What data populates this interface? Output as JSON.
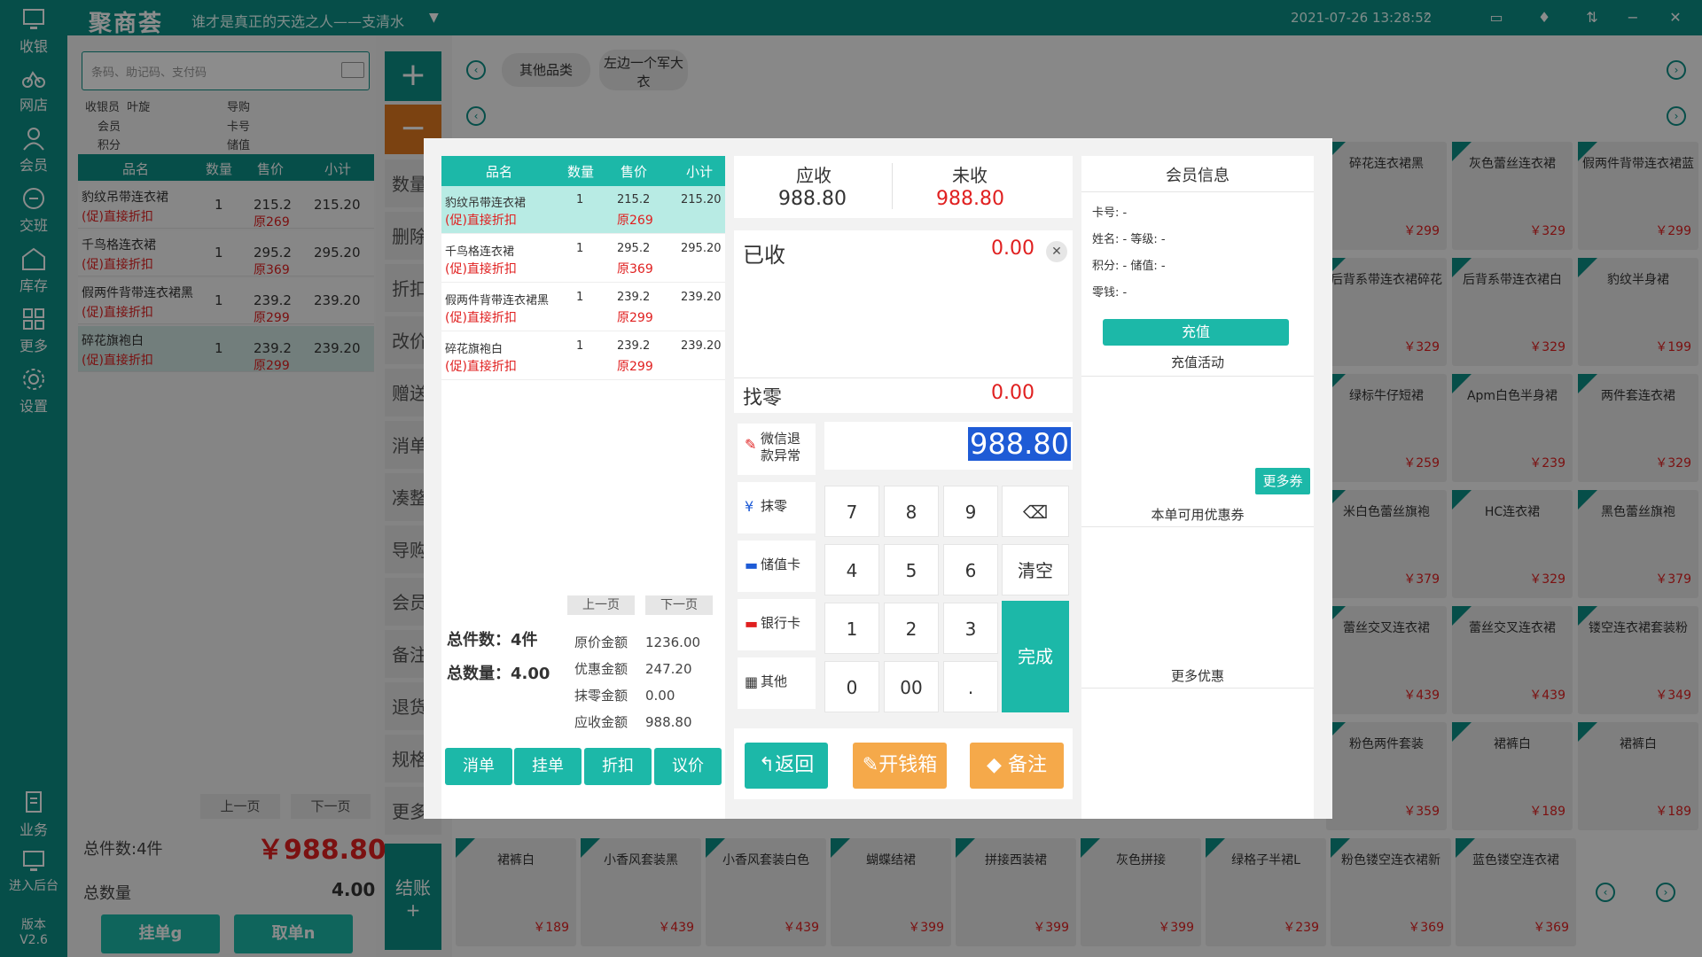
{
  "app": {
    "logo": "聚商荟",
    "slogan": "谁才是真正的天选之人——支清水",
    "datetime": "2021-07-26 13:28:52",
    "version_label": "版本",
    "version": "V2.6"
  },
  "nav": [
    "收银",
    "网店",
    "会员",
    "交班",
    "库存",
    "更多",
    "设置"
  ],
  "nav_bottom": [
    "业务",
    "进入后台"
  ],
  "search": {
    "placeholder": "条码、助记码、支付码"
  },
  "info": {
    "cashier_label": "收银员",
    "cashier": "叶旋",
    "guide_label": "导购",
    "member_label": "会员",
    "card_label": "卡号",
    "points_label": "积分",
    "balance_label": "储值"
  },
  "cart": {
    "headers": [
      "品名",
      "数量",
      "售价",
      "小计"
    ],
    "rows": [
      {
        "name": "豹纹吊带连衣裙",
        "qty": "1",
        "price": "215.2",
        "subtotal": "215.20",
        "promo": "(促)直接折扣",
        "orig": "原269"
      },
      {
        "name": "千鸟格连衣裙",
        "qty": "1",
        "price": "295.2",
        "subtotal": "295.20",
        "promo": "(促)直接折扣",
        "orig": "原369"
      },
      {
        "name": "假两件背带连衣裙黑",
        "qty": "1",
        "price": "239.2",
        "subtotal": "239.20",
        "promo": "(促)直接折扣",
        "orig": "原299"
      },
      {
        "name": "碎花旗袍白",
        "qty": "1",
        "price": "239.2",
        "subtotal": "239.20",
        "promo": "(促)直接折扣",
        "orig": "原299"
      }
    ],
    "prev": "上一页",
    "next": "下一页",
    "total_items": "总件数:4件",
    "total_amount": "￥988.80",
    "total_qty_label": "总数量",
    "total_qty": "4.00",
    "hold": "挂单g",
    "retrieve": "取单n"
  },
  "mid_buttons": [
    "数量",
    "删除",
    "折扣",
    "改价",
    "赠送",
    "消单",
    "凑整",
    "导购",
    "会员",
    "备注",
    "退货",
    "规格",
    "更多"
  ],
  "checkout": "结账",
  "categories": [
    "其他品类",
    "左边一个军大衣"
  ],
  "products": [
    {
      "name": "碎花连衣裙黑",
      "price": "￥299"
    },
    {
      "name": "灰色蕾丝连衣裙",
      "price": "￥329"
    },
    {
      "name": "假两件背带连衣裙蓝",
      "price": "￥299"
    },
    {
      "name": "后背系带连衣裙碎花",
      "price": "￥329"
    },
    {
      "name": "后背系带连衣裙白",
      "price": "￥329"
    },
    {
      "name": "豹纹半身裙",
      "price": "￥199"
    },
    {
      "name": "绿标牛仔短裙",
      "price": "￥259"
    },
    {
      "name": "Apm白色半身裙",
      "price": "￥239"
    },
    {
      "name": "两件套连衣裙",
      "price": "￥329"
    },
    {
      "name": "米白色蕾丝旗袍",
      "price": "￥379"
    },
    {
      "name": "HC连衣裙",
      "price": "￥329"
    },
    {
      "name": "黑色蕾丝旗袍",
      "price": "￥379"
    },
    {
      "name": "蕾丝交叉连衣裙",
      "price": "￥439"
    },
    {
      "name": "蕾丝交叉连衣裙",
      "price": "￥439"
    },
    {
      "name": "镂空连衣裙套装粉",
      "price": "￥349"
    },
    {
      "name": "粉色两件套装",
      "price": "￥359"
    },
    {
      "name": "裙裤白",
      "price": "￥189"
    },
    {
      "name": "裙裤白",
      "price": "￥189"
    }
  ],
  "bottom_products": [
    {
      "name": "裙裤白",
      "price": "￥189"
    },
    {
      "name": "小香风套装黑",
      "price": "￥439"
    },
    {
      "name": "小香风套装白色",
      "price": "￥439"
    },
    {
      "name": "蝴蝶结裙",
      "price": "￥399"
    },
    {
      "name": "拼接西装裙",
      "price": "￥399"
    },
    {
      "name": "灰色拼接",
      "price": "￥399"
    },
    {
      "name": "绿格子半裙L",
      "price": "￥239"
    },
    {
      "name": "粉色镂空连衣裙新",
      "price": "￥369"
    },
    {
      "name": "蓝色镂空连衣裙",
      "price": "￥369"
    }
  ],
  "modal": {
    "headers": [
      "品名",
      "数量",
      "售价",
      "小计"
    ],
    "rows": [
      {
        "name": "豹纹吊带连衣裙",
        "qty": "1",
        "price": "215.2",
        "subtotal": "215.20",
        "promo": "(促)直接折扣",
        "orig": "原269"
      },
      {
        "name": "千鸟格连衣裙",
        "qty": "1",
        "price": "295.2",
        "subtotal": "295.20",
        "promo": "(促)直接折扣",
        "orig": "原369"
      },
      {
        "name": "假两件背带连衣裙黑",
        "qty": "1",
        "price": "239.2",
        "subtotal": "239.20",
        "promo": "(促)直接折扣",
        "orig": "原299"
      },
      {
        "name": "碎花旗袍白",
        "qty": "1",
        "price": "239.2",
        "subtotal": "239.20",
        "promo": "(促)直接折扣",
        "orig": "原299"
      }
    ],
    "prev": "上一页",
    "next": "下一页",
    "total_items": "总件数：4件",
    "total_qty": "总数量：4.00",
    "orig_label": "原价金额",
    "orig_value": "1236.00",
    "disc_label": "优惠金额",
    "disc_value": "247.20",
    "round_label": "抹零金额",
    "round_value": "0.00",
    "due_label": "应收金额",
    "due_value": "988.80",
    "btn_cancel": "消单",
    "btn_hold": "挂单",
    "btn_discount": "折扣",
    "btn_bargain": "议价",
    "receivable_label": "应收",
    "receivable": "988.80",
    "unpaid_label": "未收",
    "unpaid": "988.80",
    "received_label": "已收",
    "received": "0.00",
    "change_label": "找零",
    "change": "0.00",
    "input_value": "988.80",
    "payopts": [
      "微信退款异常",
      "抹零",
      "储值卡",
      "银行卡",
      "其他"
    ],
    "keys": [
      "7",
      "8",
      "9",
      "4",
      "5",
      "6",
      "1",
      "2",
      "3",
      "0",
      "00",
      "."
    ],
    "clear": "清空",
    "done": "完成",
    "back": "返回",
    "drawer": "开钱箱",
    "remark": "备注",
    "member_title": "会员信息",
    "card_no": "卡号: -",
    "name_level": "姓名: -  等级: -",
    "points_bal": "积分: -  储值: -",
    "change_money": "零钱: -",
    "recharge": "充值",
    "recharge_activity": "充值活动",
    "more_coupons": "更多券",
    "available_coupons": "本单可用优惠券",
    "more_offers": "更多优惠"
  },
  "colors": {
    "teal": "#0b8f86",
    "accent": "#1cb8a8",
    "orange": "#f5a94a",
    "red": "#e02020"
  }
}
